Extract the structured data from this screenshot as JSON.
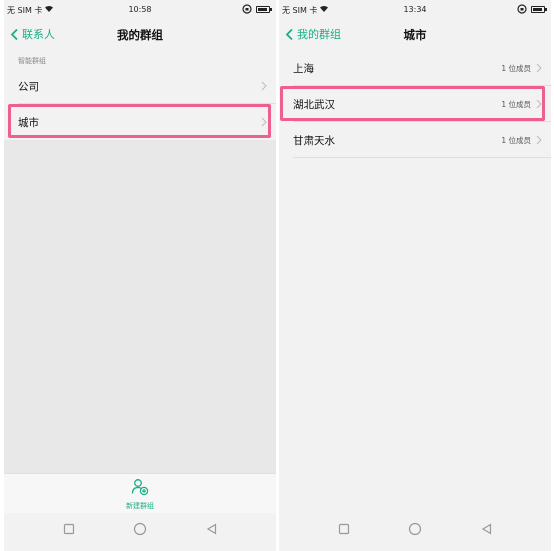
{
  "colors": {
    "accent": "#1aad85",
    "highlight": "#ee5f8e"
  },
  "left": {
    "status": {
      "carrier": "无 SIM 卡",
      "time": "10:58"
    },
    "nav": {
      "back_label": "联系人",
      "title": "我的群组"
    },
    "section_label": "智能群组",
    "items": [
      {
        "label": "公司"
      },
      {
        "label": "城市"
      }
    ],
    "bottom_action": {
      "label": "新建群组",
      "icon": "add-group-icon"
    }
  },
  "right": {
    "status": {
      "carrier": "无 SIM 卡",
      "time": "13:34"
    },
    "nav": {
      "back_label": "我的群组",
      "title": "城市"
    },
    "items": [
      {
        "label": "上海",
        "count": "1 位成员"
      },
      {
        "label": "湖北武汉",
        "count": "1 位成员"
      },
      {
        "label": "甘肃天水",
        "count": "1 位成员"
      }
    ]
  },
  "system_nav": {
    "icons": [
      "recent-apps-icon",
      "home-icon",
      "back-icon"
    ]
  }
}
